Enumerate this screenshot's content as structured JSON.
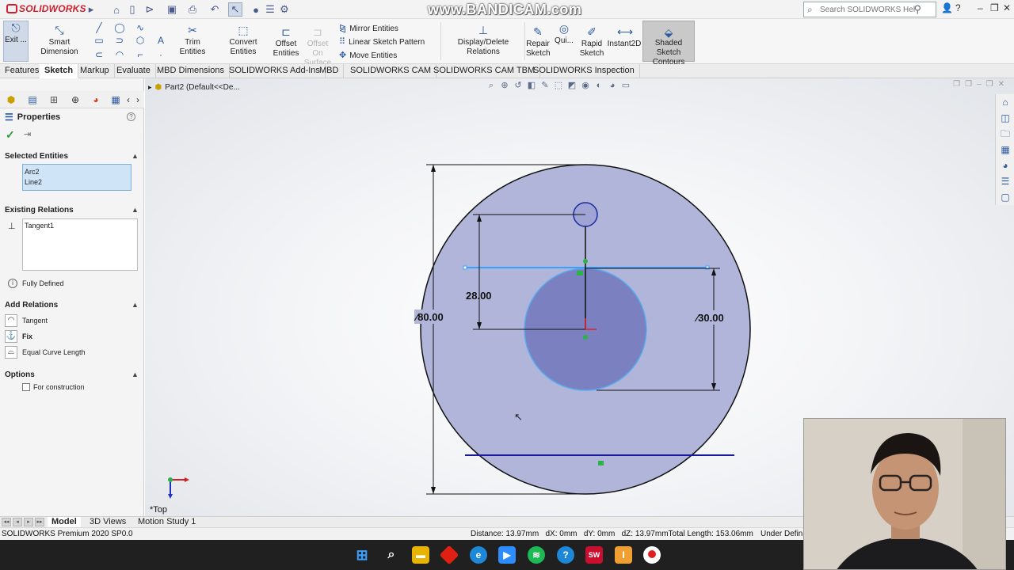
{
  "app": {
    "logo": "SOLIDWORKS",
    "watermark": "www.BANDICAM.com",
    "search_placeholder": "Search SOLIDWORKS Help"
  },
  "ribbon": {
    "exit_sketch": "Exit ...",
    "smart_dimension": "Smart Dimension",
    "trim_entities": "Trim Entities",
    "convert_entities": "Convert Entities",
    "offset_entities": "Offset Entities",
    "offset_on_surface": "Offset On Surface",
    "mirror_entities": "Mirror Entities",
    "linear_sketch_pattern": "Linear Sketch Pattern",
    "move_entities": "Move Entities",
    "display_delete_relations": "Display/Delete Relations",
    "repair_sketch": "Repair Sketch",
    "quick_snaps": "Qui...",
    "rapid_sketch": "Rapid Sketch",
    "instant2d": "Instant2D",
    "shaded_sketch_contours": "Shaded Sketch Contours"
  },
  "tabs": [
    "Features",
    "Sketch",
    "Markup",
    "Evaluate",
    "MBD Dimensions",
    "SOLIDWORKS Add-Ins",
    "MBD",
    "SOLIDWORKS CAM",
    "SOLIDWORKS CAM TBM",
    "SOLIDWORKS Inspection"
  ],
  "active_tab": "Sketch",
  "property_manager": {
    "title": "Properties",
    "selected_entities_title": "Selected Entities",
    "selected_entities": [
      "Arc2",
      "Line2"
    ],
    "existing_relations_title": "Existing Relations",
    "existing_relations": [
      "Tangent1"
    ],
    "status": "Fully Defined",
    "add_relations_title": "Add Relations",
    "add_relations": [
      "Tangent",
      "Fix",
      "Equal Curve Length"
    ],
    "options_title": "Options",
    "for_construction": "For construction"
  },
  "graphics": {
    "breadcrumb": "Part2  (Default<<De...",
    "view_label": "*Top",
    "dimensions": {
      "outer_diameter": "∕80.00",
      "inner_diameter": "∕30.00",
      "vertical_offset": "28.00"
    },
    "colors": {
      "outer_fill": "#b0b4d8",
      "inner_fill": "#7b7fbf",
      "selected": "#3aa0ff",
      "dimension_line": "#000000"
    }
  },
  "bottom_tabs": [
    "Model",
    "3D Views",
    "Motion Study 1"
  ],
  "active_bottom_tab": "Model",
  "status": {
    "product": "SOLIDWORKS Premium 2020 SP0.0",
    "measure": "Distance: 13.97mm   dX: 0mm   dY: 0mm   dZ: 13.97mmTotal Length: 153.06mm",
    "state": "Under Defin"
  },
  "taskbar": [
    "windows-icon",
    "search-icon",
    "file-explorer-icon",
    "red-app-icon",
    "edge-icon",
    "zoom-icon",
    "spotify-icon",
    "help-icon",
    "solidworks-icon",
    "sublime-icon",
    "record-icon"
  ]
}
